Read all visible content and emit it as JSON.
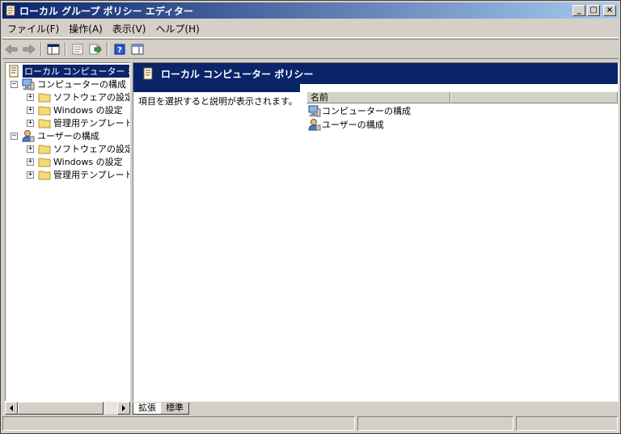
{
  "window": {
    "title": "ローカル グループ ポリシー エディター"
  },
  "title_buttons": {
    "minimize": "_",
    "maximize": "□",
    "close": "×"
  },
  "menu": [
    {
      "label": "ファイル(F)"
    },
    {
      "label": "操作(A)"
    },
    {
      "label": "表示(V)"
    },
    {
      "label": "ヘルプ(H)"
    }
  ],
  "tree": {
    "root": "ローカル コンピューター ポリシー",
    "computer": {
      "label": "コンピューターの構成",
      "children": [
        "ソフトウェアの設定",
        "Windows の設定",
        "管理用テンプレート"
      ]
    },
    "user": {
      "label": "ユーザーの構成",
      "children": [
        "ソフトウェアの設定",
        "Windows の設定",
        "管理用テンプレート"
      ]
    },
    "collapse_glyph": "−",
    "expand_glyph": "+"
  },
  "right": {
    "header": "ローカル コンピューター ポリシー",
    "description": "項目を選択すると説明が表示されます。",
    "column_name": "名前",
    "items": [
      "コンピューターの構成",
      "ユーザーの構成"
    ]
  },
  "tabs": {
    "extended": "拡張",
    "standard": "標準"
  },
  "status": [
    "",
    "",
    ""
  ],
  "colors": {
    "selection": "#0a246a",
    "titlebar_start": "#0a246a",
    "titlebar_end": "#a6caf0",
    "face": "#d4d0c8"
  }
}
